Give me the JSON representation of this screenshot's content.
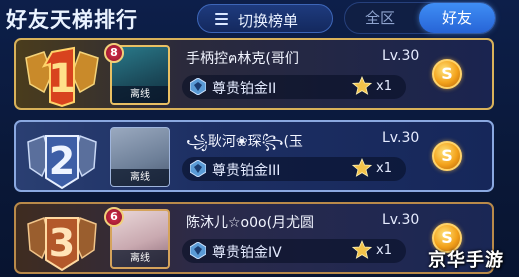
{
  "header": {
    "title": "好友天梯排行",
    "switch_label": "切换榜单",
    "tabs": [
      {
        "label": "全区",
        "selected": false
      },
      {
        "label": "好友",
        "selected": true
      }
    ]
  },
  "rows": [
    {
      "rank": "1",
      "name": "手柄控ฅ林克(哥们",
      "level": "Lv.30",
      "status": "离线",
      "badge": "8",
      "tier": "尊贵铂金II",
      "stars": "x1"
    },
    {
      "rank": "2",
      "name": "꧁耿河❀琛꧂(玉",
      "level": "Lv.30",
      "status": "离线",
      "badge": "",
      "tier": "尊贵铂金III",
      "stars": "x1"
    },
    {
      "rank": "3",
      "name": "陈沐儿☆o0o(月尤圆",
      "level": "Lv.30",
      "status": "离线",
      "badge": "6",
      "tier": "尊贵铂金IV",
      "stars": "x1"
    }
  ],
  "watermark": "京华手游",
  "colors": {
    "gold": "#d9b25a",
    "silver": "#8aa8e0",
    "bronze": "#b98a4a",
    "accent": "#3f8ef5"
  }
}
